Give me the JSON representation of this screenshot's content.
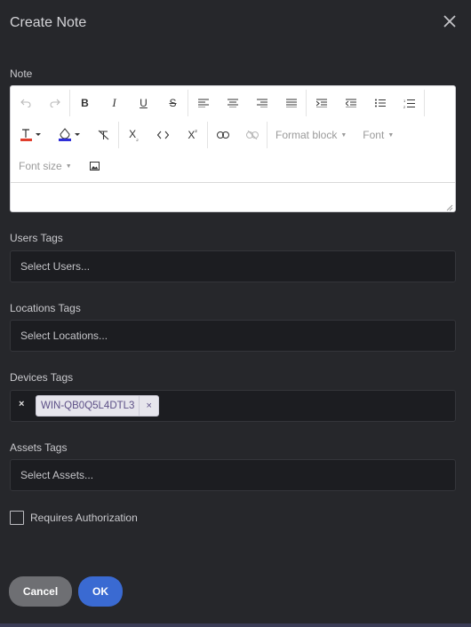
{
  "header": {
    "title": "Create Note"
  },
  "note": {
    "label": "Note",
    "toolbar": {
      "format_block": "Format block",
      "font": "Font",
      "font_size": "Font size",
      "text_color": "#e03e2d",
      "highlight_color": "#2f2fd8"
    }
  },
  "users": {
    "label": "Users Tags",
    "placeholder": "Select Users..."
  },
  "locations": {
    "label": "Locations Tags",
    "placeholder": "Select Locations..."
  },
  "devices": {
    "label": "Devices Tags",
    "clear": "×",
    "tags": [
      "WIN-QB0Q5L4DTL3"
    ],
    "remove": "×"
  },
  "assets": {
    "label": "Assets Tags",
    "placeholder": "Select Assets..."
  },
  "authorization": {
    "label": "Requires Authorization",
    "checked": false
  },
  "footer": {
    "cancel": "Cancel",
    "ok": "OK"
  }
}
